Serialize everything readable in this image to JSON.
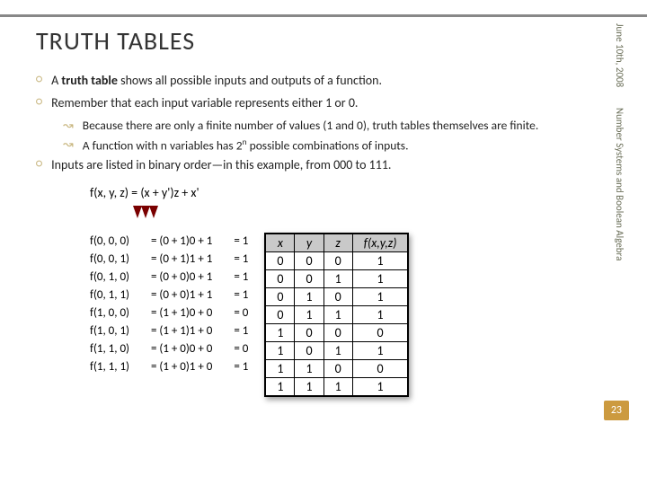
{
  "meta": {
    "date": "June 10th, 2008",
    "topic": "Number Systems and Boolean Algebra",
    "page": "23"
  },
  "title": "TRUTH TABLES",
  "bullets": {
    "b1": {
      "pre": "A ",
      "bold": "truth table",
      "post": " shows all possible inputs and outputs of a function."
    },
    "b2": "Remember that each input variable represents either 1 or 0.",
    "b2a": "Because there are only a finite number of values (1 and 0), truth tables themselves are finite.",
    "b2b": {
      "pre": "A function with n variables has 2",
      "sup": "n",
      "post": " possible combinations of inputs."
    },
    "b3": "Inputs are listed in binary order—in this example, from 000 to 111."
  },
  "equation": "f(x, y, z) = (x + y')z + x'",
  "eval": {
    "labels": [
      "f(0, 0, 0)",
      "f(0, 0, 1)",
      "f(0, 1, 0)",
      "f(0, 1, 1)",
      "f(1, 0, 0)",
      "f(1, 0, 1)",
      "f(1, 1, 0)",
      "f(1, 1, 1)"
    ],
    "exprs": [
      "= (0 + 1)0 + 1",
      "= (0 + 1)1 + 1",
      "= (0 + 0)0 + 1",
      "= (0 + 0)1 + 1",
      "= (1 + 1)0 + 0",
      "= (1 + 1)1 + 0",
      "= (1 + 0)0 + 0",
      "= (1 + 0)1 + 0"
    ],
    "results": [
      "= 1",
      "= 1",
      "= 1",
      "= 1",
      "= 0",
      "= 1",
      "= 0",
      "= 1"
    ]
  },
  "table": {
    "headers": [
      "x",
      "y",
      "z",
      "f(x,y,z)"
    ],
    "rows": [
      [
        "0",
        "0",
        "0",
        "1"
      ],
      [
        "0",
        "0",
        "1",
        "1"
      ],
      [
        "0",
        "1",
        "0",
        "1"
      ],
      [
        "0",
        "1",
        "1",
        "1"
      ],
      [
        "1",
        "0",
        "0",
        "0"
      ],
      [
        "1",
        "0",
        "1",
        "1"
      ],
      [
        "1",
        "1",
        "0",
        "0"
      ],
      [
        "1",
        "1",
        "1",
        "1"
      ]
    ]
  },
  "chart_data": {
    "type": "table",
    "title": "Truth table for f(x,y,z) = (x + y')z + x'",
    "columns": [
      "x",
      "y",
      "z",
      "f(x,y,z)"
    ],
    "rows": [
      [
        0,
        0,
        0,
        1
      ],
      [
        0,
        0,
        1,
        1
      ],
      [
        0,
        1,
        0,
        1
      ],
      [
        0,
        1,
        1,
        1
      ],
      [
        1,
        0,
        0,
        0
      ],
      [
        1,
        0,
        1,
        1
      ],
      [
        1,
        1,
        0,
        0
      ],
      [
        1,
        1,
        1,
        1
      ]
    ]
  }
}
